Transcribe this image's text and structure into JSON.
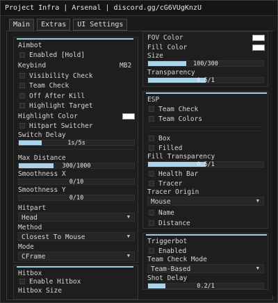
{
  "window": {
    "title": "Project Infra | Arsenal | discord.gg/cG6VUgKnzU"
  },
  "tabs": [
    {
      "label": "Main"
    },
    {
      "label": "Extras"
    },
    {
      "label": "UI Settings"
    }
  ],
  "aimbot": {
    "title": "Aimbot",
    "enabled_label": "Enabled [Hold]",
    "keybind_label": "Keybind",
    "keybind_value": "MB2",
    "visibility_check_label": "Visibility Check",
    "team_check_label": "Team Check",
    "off_after_kill_label": "Off After Kill",
    "highlight_target_label": "Highlight Target",
    "highlight_color_label": "Highlight Color",
    "hitpart_switcher_label": "Hitpart Switcher",
    "switch_delay": {
      "label": "Switch Delay",
      "value": "1s/5s",
      "fraction": 0.2
    },
    "max_distance": {
      "label": "Max Distance",
      "value": "300/1000",
      "fraction": 0.3
    },
    "smoothness_x": {
      "label": "Smoothness X",
      "value": "0/10",
      "fraction": 0
    },
    "smoothness_y": {
      "label": "Smoothness Y",
      "value": "0/10",
      "fraction": 0
    },
    "hitpart": {
      "label": "Hitpart",
      "value": "Head"
    },
    "method": {
      "label": "Method",
      "value": "Closest To Mouse"
    },
    "mode": {
      "label": "Mode",
      "value": "CFrame"
    },
    "colors": {
      "highlight": "#ffffff"
    }
  },
  "hitbox": {
    "title": "Hitbox",
    "enable_label": "Enable Hitbox",
    "size_label": "Hitbox Size"
  },
  "fov": {
    "fov_color_label": "FOV Color",
    "fill_color_label": "Fill Color",
    "size": {
      "label": "Size",
      "value": "100/300",
      "fraction": 0.333
    },
    "transparency": {
      "label": "Transparency",
      "value": "0.5/1",
      "fraction": 0.5
    },
    "colors": {
      "fov": "#ffffff",
      "fill": "#ffffff"
    }
  },
  "esp": {
    "title": "ESP",
    "team_check_label": "Team Check",
    "team_colors_label": "Team Colors",
    "box_label": "Box",
    "filled_label": "Filled",
    "fill_transparency": {
      "label": "Fill Transparency",
      "value": "0.5/1",
      "fraction": 0.5
    },
    "health_bar_label": "Health Bar",
    "tracer_label": "Tracer",
    "tracer_origin": {
      "label": "Tracer Origin",
      "value": "Mouse"
    },
    "name_label": "Name",
    "distance_label": "Distance"
  },
  "triggerbot": {
    "title": "Triggerbot",
    "enabled_label": "Enabled",
    "team_check_mode": {
      "label": "Team Check Mode",
      "value": "Team-Based"
    },
    "shot_delay": {
      "label": "Shot Delay",
      "value": "0.2/1",
      "fraction": 0.15
    }
  },
  "theme": {
    "accent": "#a9d3e8",
    "background": "#1c1c1c"
  }
}
